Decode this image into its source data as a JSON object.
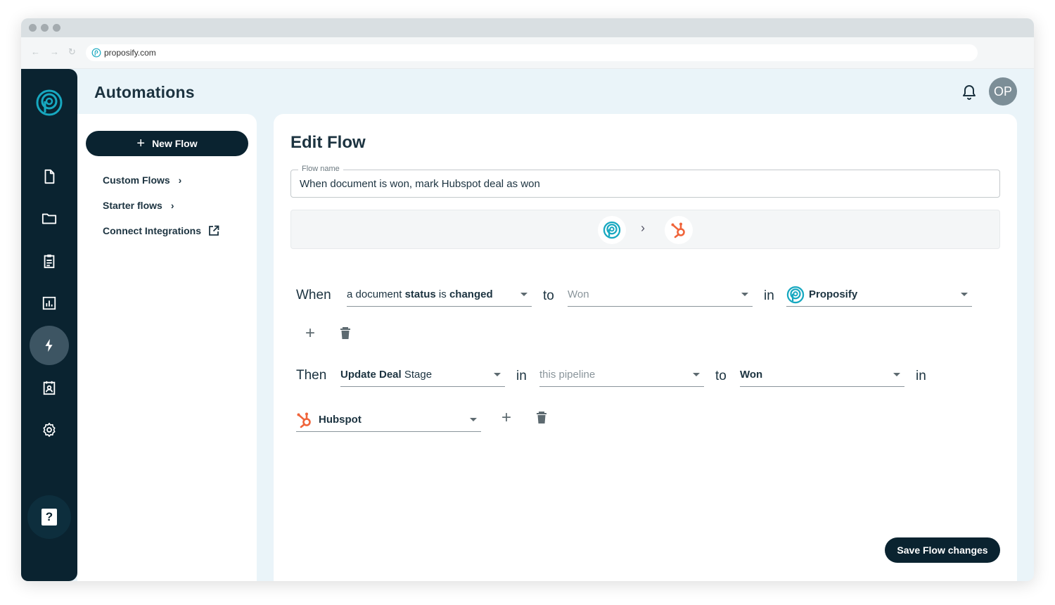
{
  "browser": {
    "url": "proposify.com",
    "back": "←",
    "forward": "→",
    "reload": "↻"
  },
  "header": {
    "title": "Automations",
    "avatar_initials": "OP"
  },
  "rail": {
    "items": [
      {
        "icon": "document-icon"
      },
      {
        "icon": "folder-icon"
      },
      {
        "icon": "clipboard-icon"
      },
      {
        "icon": "chart-icon"
      },
      {
        "icon": "lightning-icon",
        "active": true
      },
      {
        "icon": "contact-card-icon"
      },
      {
        "icon": "gear-icon"
      }
    ],
    "help_label": "?"
  },
  "subnav": {
    "new_flow": "New Flow",
    "plus": "+",
    "links": [
      {
        "label": "Custom Flows",
        "chevron": "›"
      },
      {
        "label": "Starter flows",
        "chevron": "›"
      },
      {
        "label": "Connect Integrations"
      }
    ]
  },
  "main": {
    "title": "Edit Flow",
    "flow_name_label": "Flow name",
    "flow_name_value": "When document is won, mark Hubspot deal as won",
    "connector_chevron": "›",
    "when": {
      "keyword": "When",
      "trigger_pre": "a document",
      "trigger_bold1": "status",
      "trigger_mid": "is",
      "trigger_bold2": "changed",
      "to_keyword": "to",
      "status_value": "Won",
      "in_keyword": "in",
      "app": "Proposify"
    },
    "then": {
      "keyword": "Then",
      "action_bold": "Update Deal",
      "action_rest": "Stage",
      "in_keyword": "in",
      "pipeline_placeholder": "this pipeline",
      "to_keyword": "to",
      "stage_value": "Won",
      "in_keyword2": "in",
      "app": "Hubspot"
    },
    "add_symbol": "+",
    "save_label": "Save Flow changes"
  },
  "colors": {
    "navy": "#0a2330",
    "teal": "#17a8c0",
    "hubspot_orange": "#f0643a",
    "background": "#eaf4f9"
  }
}
